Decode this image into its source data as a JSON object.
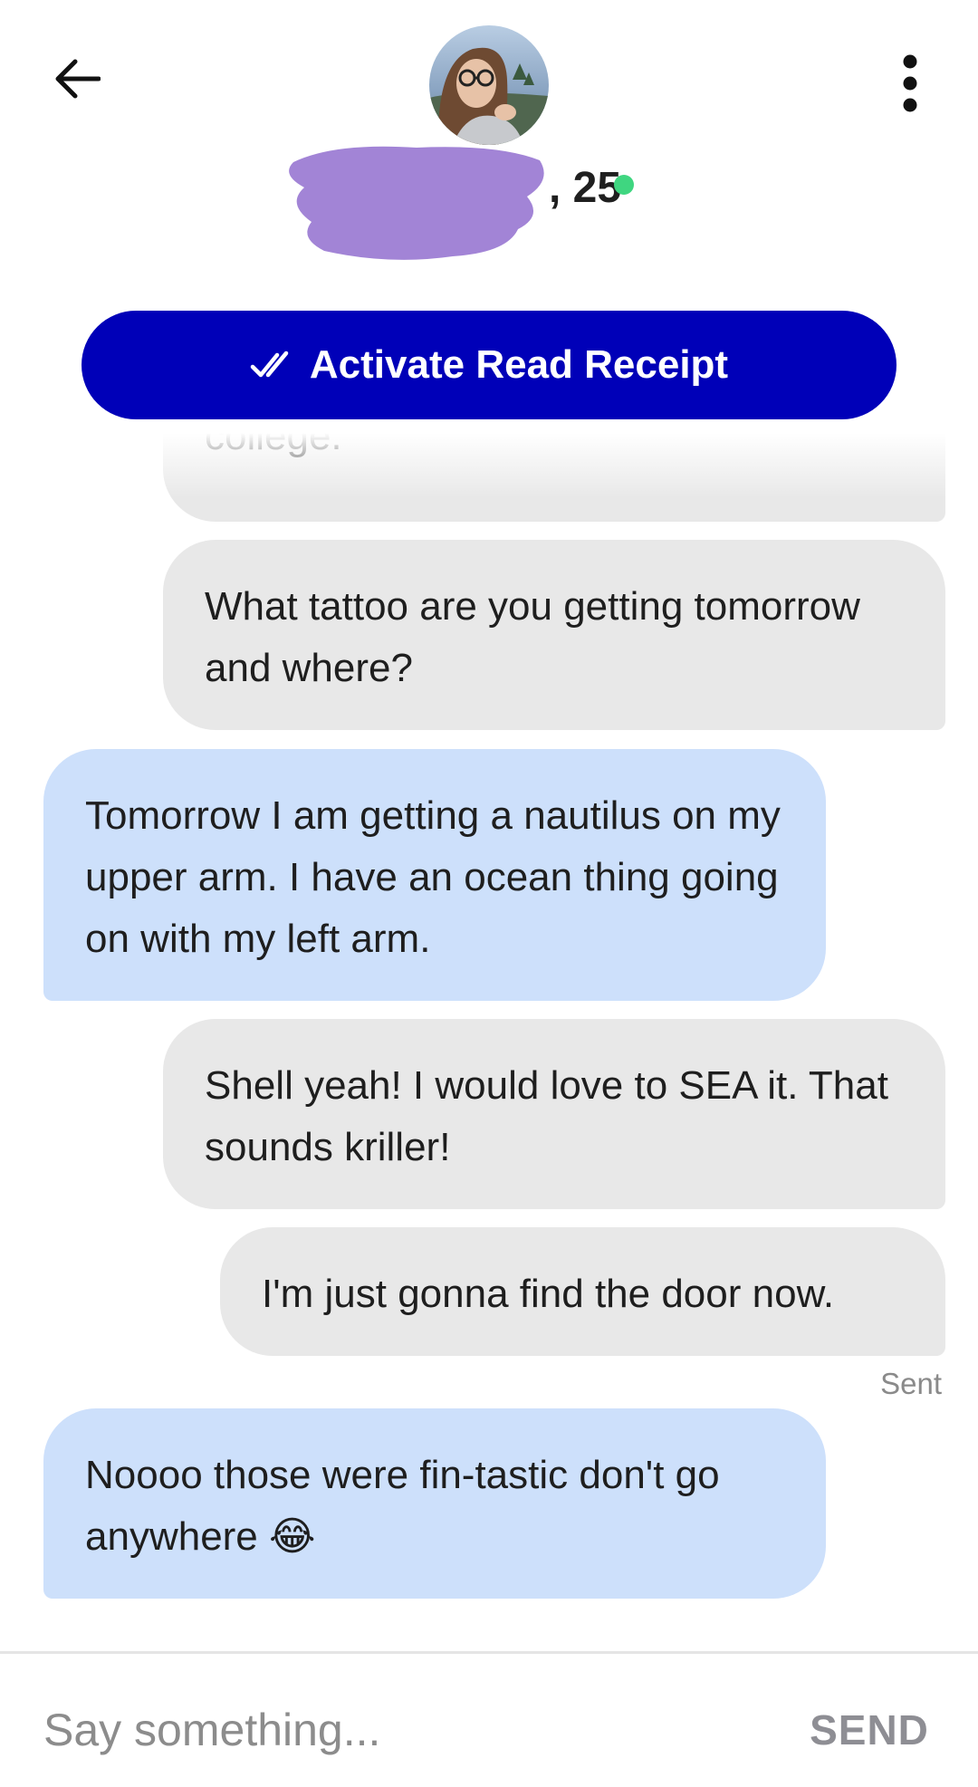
{
  "header": {
    "back_icon": "arrow-left-icon",
    "menu_icon": "more-vertical-icon",
    "profile_age": ", 25",
    "online_color": "#3fd680"
  },
  "read_receipt": {
    "label": "Activate Read Receipt",
    "icon": "double-check-icon",
    "color": "#0000b8"
  },
  "messages": [
    {
      "from": "me",
      "text": "college."
    },
    {
      "from": "me",
      "text": "What tattoo are you getting tomorrow and where?"
    },
    {
      "from": "them",
      "text": "Tomorrow I am getting a nautilus on my upper arm. I have an ocean thing going on with my left arm."
    },
    {
      "from": "me",
      "text": "Shell yeah! I would love to SEA it. That sounds kriller!"
    },
    {
      "from": "me",
      "text": "I'm just gonna find the door now."
    },
    {
      "from": "them",
      "text": "Noooo those were fin-tastic don't go anywhere",
      "emoji": "😂"
    }
  ],
  "status": {
    "sent_label": "Sent"
  },
  "composer": {
    "placeholder": "Say something...",
    "send_label": "SEND"
  },
  "colors": {
    "sent_bubble": "#e8e8e8",
    "received_bubble": "#cde0fb"
  }
}
